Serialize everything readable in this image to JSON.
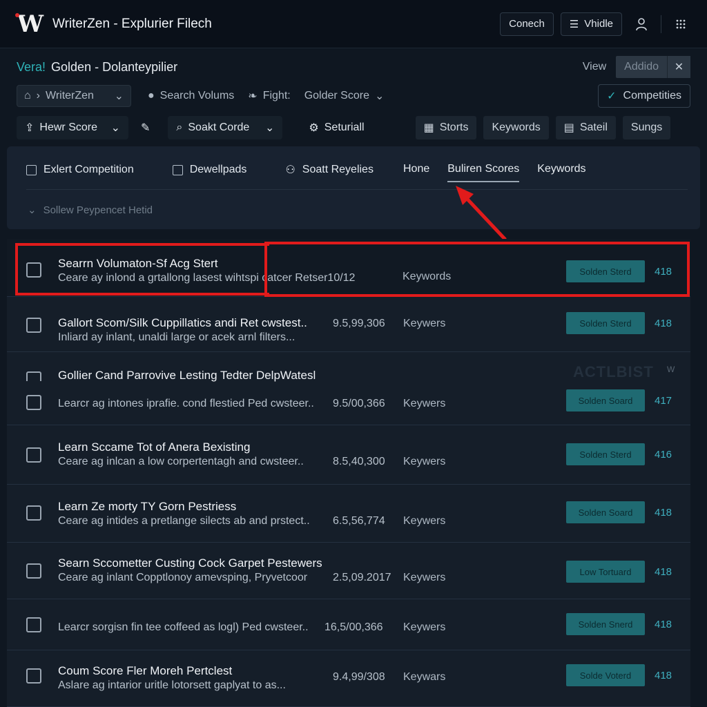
{
  "app": {
    "title": "WriterZen - Explurier Filech",
    "logo_text": "W",
    "buttons": {
      "conech": "Conech",
      "vhidle": "Vhidle"
    }
  },
  "breadcrumb": {
    "accent": "Vera!",
    "main": "Golden - Dolanteypilier",
    "view": "View",
    "add": "Addido"
  },
  "filters": {
    "workspace": "WriterZen",
    "search_volume": "Search Volums",
    "fight": "Fight:",
    "golden_score": "Golder Score",
    "competities": "Competities"
  },
  "toolbar": {
    "hewr_score": "Hewr Score",
    "soakt_corde": "Soakt Corde",
    "seturiall": "Seturiall",
    "tabs": [
      "Storts",
      "Keywords",
      "Sateil",
      "Sungs"
    ]
  },
  "panel": {
    "options": [
      "Exlert Competition",
      "Dewellpads",
      "Soatt Reyelies"
    ],
    "tabs": [
      "Hone",
      "Buliren Scores",
      "Keywords"
    ],
    "collapse": "Sollew Peypencet Hetid"
  },
  "watermark": {
    "text": "ACTLBIST",
    "mark": "W"
  },
  "rows": [
    {
      "title": "Searrn Volumaton-Sf Acg Stert",
      "desc": "Ceare ay inlond a grtallong lasest wihtspi catcer Retser10/12",
      "kw": "Keywords",
      "badge": "Solden Sterd",
      "score": "418"
    },
    {
      "title": "Gallort Scom/Silk Cuppillatics andi Ret cwstest..",
      "desc": "Inliard ay inlant, unaldi large or acek arnl filters...",
      "kw": "Keywers",
      "badge": "Solden Sterd",
      "score": "418",
      "extra": "9.5,99,306"
    },
    {
      "title": "Gollier Cand Parrovive Lesting Tedter DelpWatesl",
      "desc": "Learcr ag intones iprafie. cond flestied Ped cwsteer..",
      "kw": "Keywers",
      "badge": "Solden Soard",
      "score": "417",
      "extra": "9.5/00,366"
    },
    {
      "title": "Learn Sccame Tot of Anera Bexisting",
      "desc": "Ceare ag inlcan a low corpertentagh and cwsteer..",
      "kw": "Keywers",
      "badge": "Solden Sterd",
      "score": "416",
      "extra": "8.5,40,300"
    },
    {
      "title": "Learn Ze morty TY Gorn Pestriess",
      "desc": "Ceare ag intides a pretlange silects ab and prstect..",
      "kw": "Keywers",
      "badge": "Solden Soard",
      "score": "418",
      "extra": "6.5,56,774"
    },
    {
      "title": "Searn Sccometter Custing Cock Garpet Pestewers",
      "desc": "Ceare ag inlant Copptlonoy amevsping, Pryvetcoor",
      "kw": "Keywers",
      "badge": "Low Tortuard",
      "score": "418",
      "extra": "2.5,09.2017"
    },
    {
      "title": "",
      "desc": "Learcr sorgisn fin tee coffeed as logl) Ped cwsteer..",
      "kw": "Keywers",
      "badge": "Solden Snerd",
      "score": "418",
      "extra": "16,5/00,366"
    },
    {
      "title": "Coum Score Fler Moreh Pertclest",
      "desc": "Aslare ag intarior uritle lotorsett gaplyat to as...",
      "kw": "Keywars",
      "badge": "Solde Voterd",
      "score": "418",
      "extra": "9.4,99/308"
    }
  ],
  "colors": {
    "accent": "#2fb3b8",
    "highlight": "#e11b1b",
    "badge": "#1f6a72"
  }
}
